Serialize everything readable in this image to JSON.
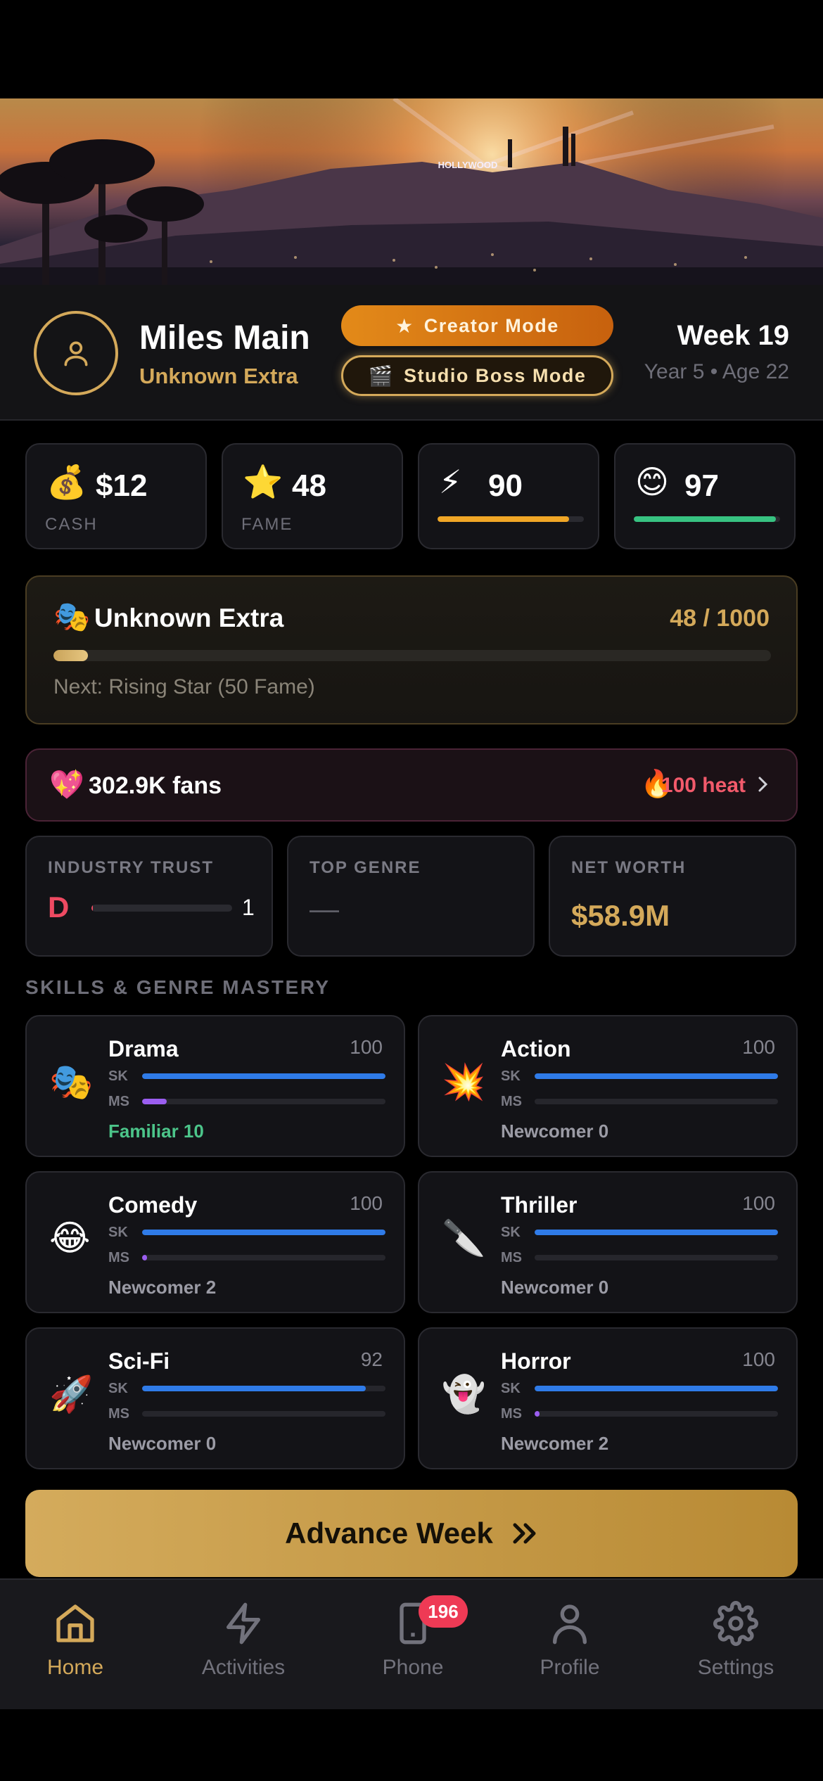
{
  "hero": {
    "sign_text": "HOLLYWOOD"
  },
  "player": {
    "name": "Miles Main",
    "title": "Unknown Extra",
    "week": "Week 19",
    "year_age": "Year 5 • Age 22"
  },
  "modes": {
    "creator": "Creator Mode",
    "studio": "Studio Boss Mode"
  },
  "stats": {
    "cash": {
      "emoji": "💰",
      "value": "$12",
      "label": "CASH"
    },
    "fame": {
      "emoji": "⭐",
      "value": "48",
      "label": "FAME"
    },
    "energy": {
      "emoji": "⚡",
      "value": "90",
      "level": 0.9,
      "color": "#f0a626"
    },
    "happiness": {
      "emoji": "😊",
      "value": "97",
      "level": 0.97,
      "color": "#37c281"
    }
  },
  "career": {
    "emoji": "🎭",
    "title": "Unknown Extra",
    "progress_text": "48 / 1000",
    "progress": 0.048,
    "next": "Next: Rising Star (50 Fame)"
  },
  "fans": {
    "emoji": "💖",
    "text": "302.9K fans",
    "heat_emoji": "🔥",
    "heat_text": "100 heat"
  },
  "info": {
    "trust_label": "INDUSTRY TRUST",
    "trust_grade": "D",
    "trust_value": "1",
    "trust_level": 0.01,
    "genre_label": "TOP GENRE",
    "genre_value": "—",
    "worth_label": "NET WORTH",
    "worth_value": "$58.9M"
  },
  "skills_title": "SKILLS & GENRE MASTERY",
  "skill_labels": {
    "sk": "SK",
    "ms": "MS"
  },
  "skills": [
    {
      "emoji": "🎭",
      "name": "Drama",
      "score": "100",
      "sk": 1.0,
      "ms": 0.1,
      "rank": "Familiar 10"
    },
    {
      "emoji": "💥",
      "name": "Action",
      "score": "100",
      "sk": 1.0,
      "ms": 0.0,
      "rank": "Newcomer 0"
    },
    {
      "emoji": "😂",
      "name": "Comedy",
      "score": "100",
      "sk": 1.0,
      "ms": 0.02,
      "rank": "Newcomer 2"
    },
    {
      "emoji": "🔪",
      "name": "Thriller",
      "score": "100",
      "sk": 1.0,
      "ms": 0.0,
      "rank": "Newcomer 0"
    },
    {
      "emoji": "🚀",
      "name": "Sci-Fi",
      "score": "92",
      "sk": 0.92,
      "ms": 0.0,
      "rank": "Newcomer 0"
    },
    {
      "emoji": "👻",
      "name": "Horror",
      "score": "100",
      "sk": 1.0,
      "ms": 0.02,
      "rank": "Newcomer 2"
    }
  ],
  "advance_label": "Advance Week",
  "nav": {
    "home": "Home",
    "activities": "Activities",
    "phone": "Phone",
    "phone_badge": "196",
    "profile": "Profile",
    "settings": "Settings"
  }
}
